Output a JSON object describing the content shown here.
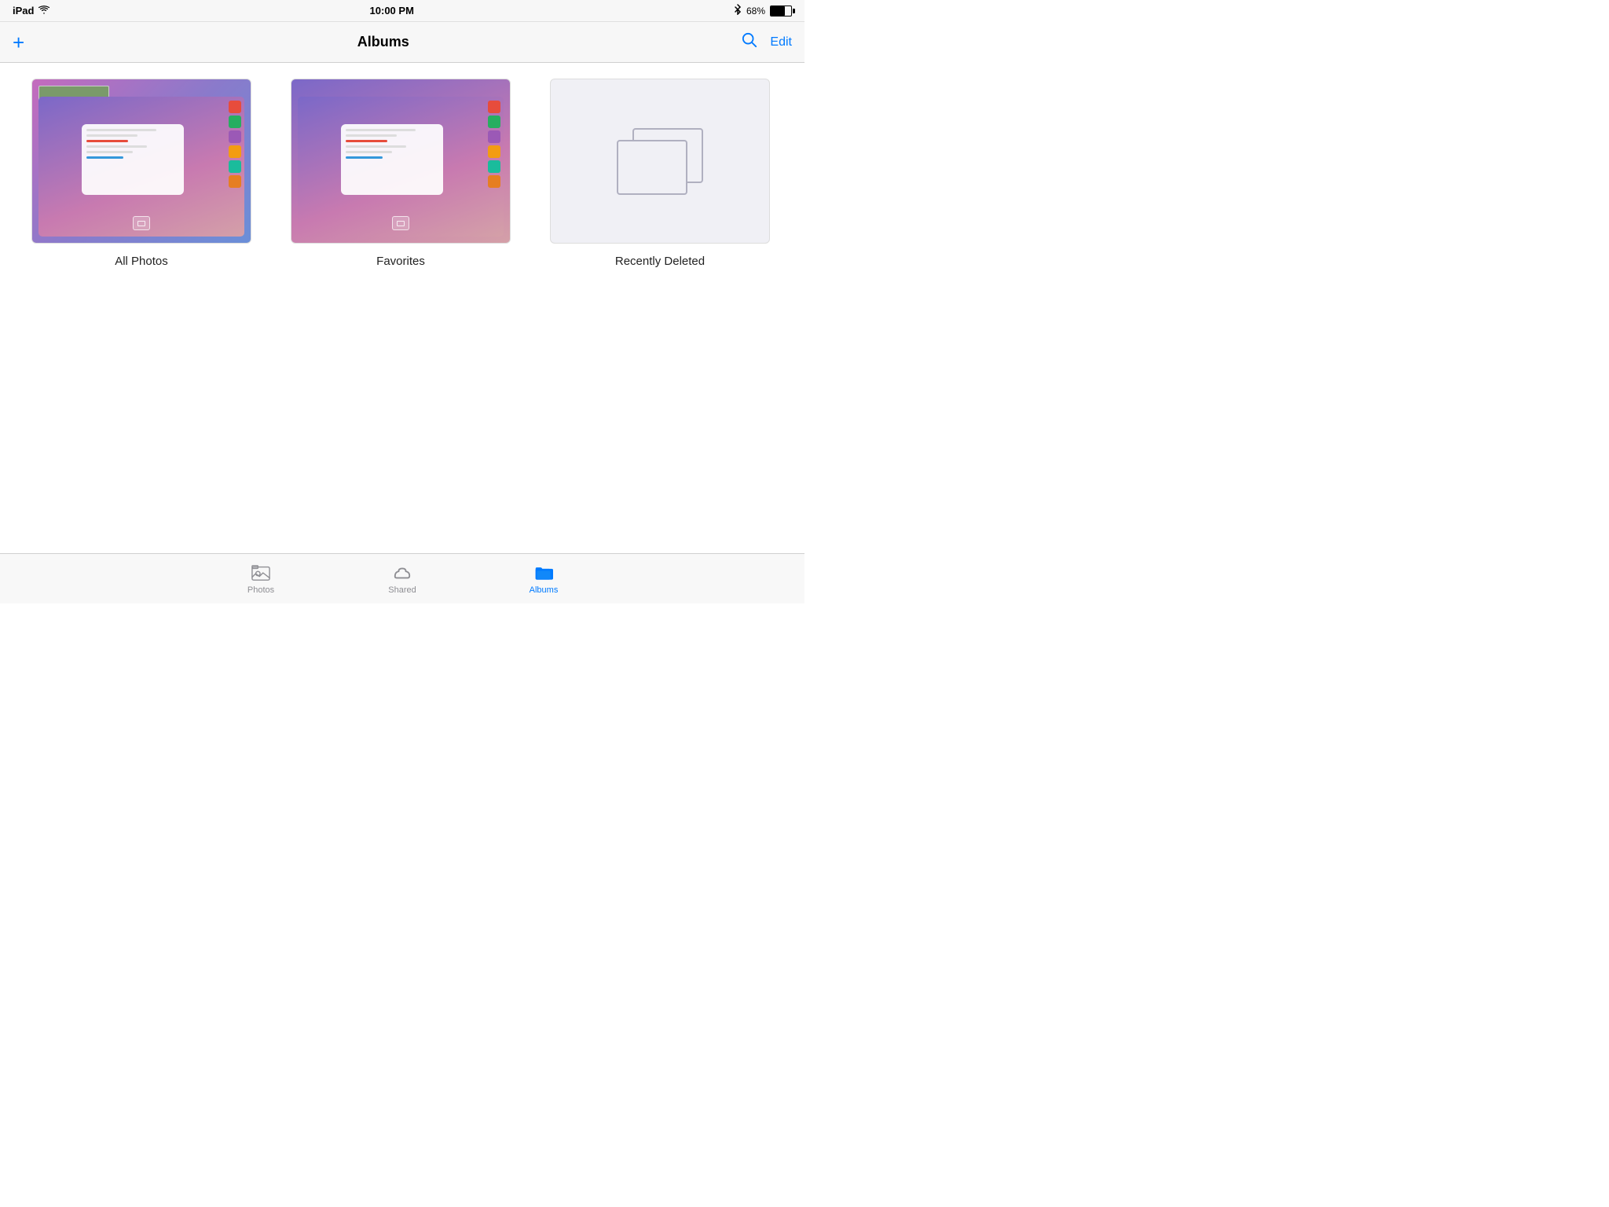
{
  "status_bar": {
    "device": "iPad",
    "wifi": true,
    "time": "10:00 PM",
    "bluetooth": true,
    "battery_percent": "68%"
  },
  "nav_bar": {
    "title": "Albums",
    "add_label": "+",
    "edit_label": "Edit"
  },
  "albums": [
    {
      "id": "all-photos",
      "label": "All Photos"
    },
    {
      "id": "favorites",
      "label": "Favorites"
    },
    {
      "id": "recently-deleted",
      "label": "Recently Deleted"
    }
  ],
  "tab_bar": {
    "items": [
      {
        "id": "photos",
        "label": "Photos",
        "active": false
      },
      {
        "id": "shared",
        "label": "Shared",
        "active": false
      },
      {
        "id": "albums",
        "label": "Albums",
        "active": true
      }
    ]
  }
}
